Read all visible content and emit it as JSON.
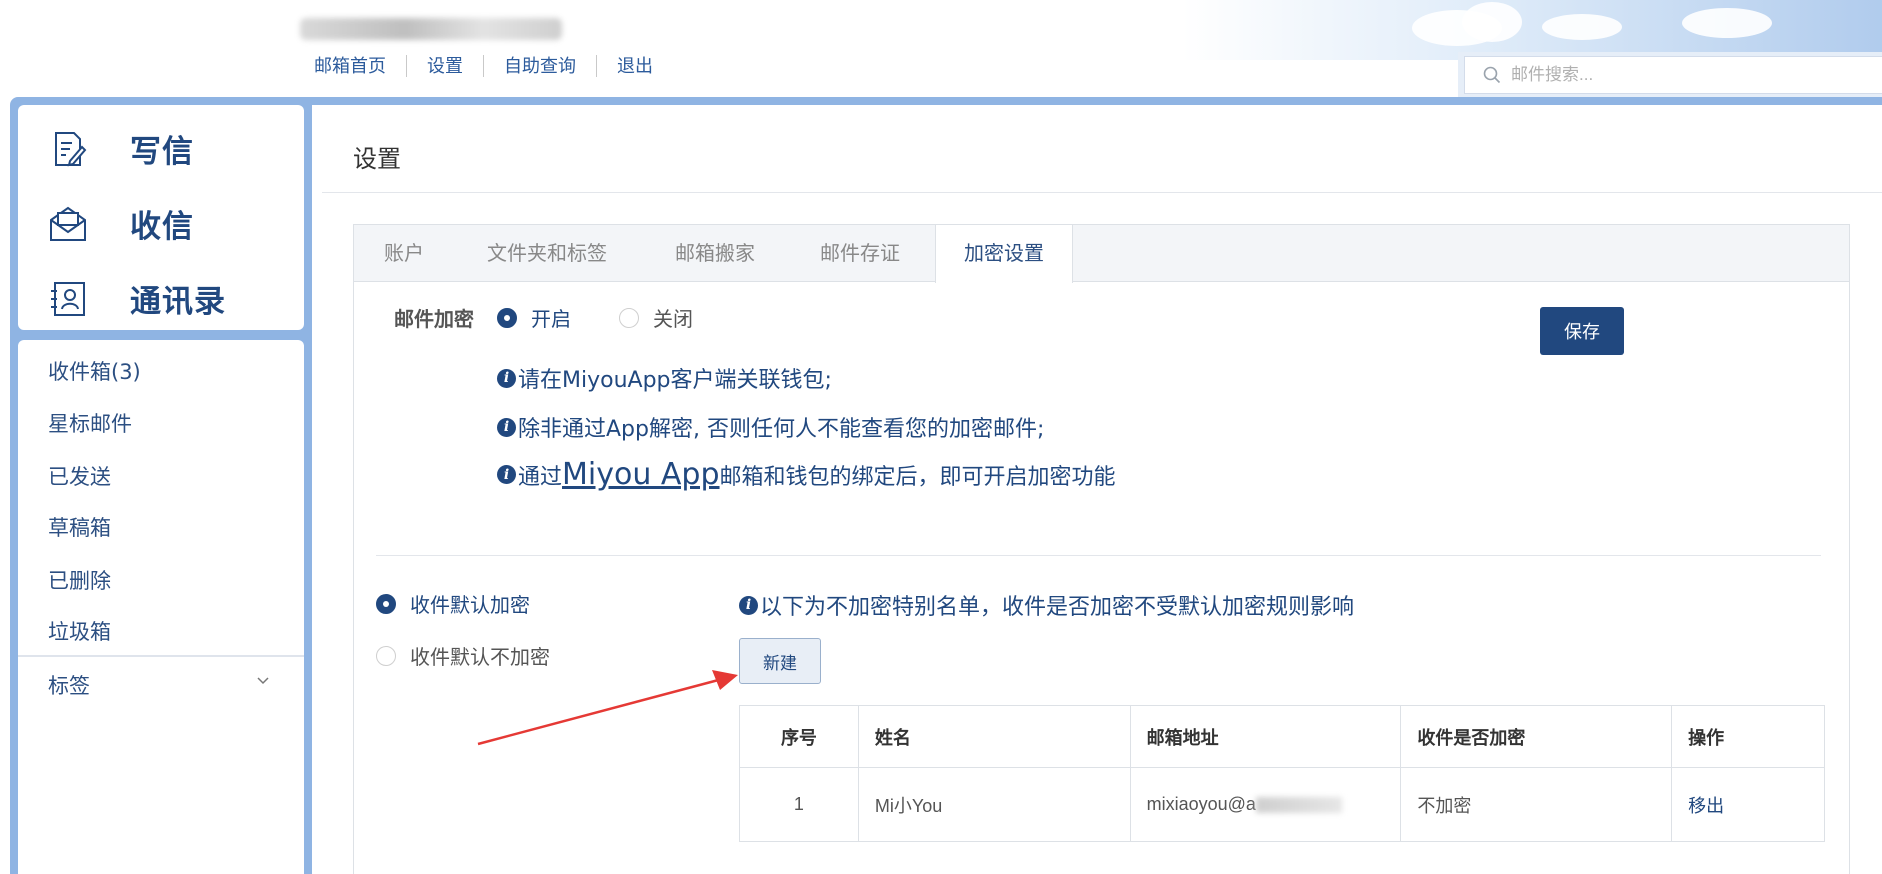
{
  "header": {
    "nav": [
      "邮箱首页",
      "设置",
      "自助查询",
      "退出"
    ],
    "search_placeholder": "邮件搜索..."
  },
  "sidebar": {
    "actions": [
      {
        "label": "写信",
        "icon": "compose-icon"
      },
      {
        "label": "收信",
        "icon": "inbox-envelope-icon"
      },
      {
        "label": "通讯录",
        "icon": "contacts-icon"
      }
    ],
    "folders": [
      "收件箱(3)",
      "星标邮件",
      "已发送",
      "草稿箱",
      "已删除",
      "垃圾箱"
    ],
    "tags_label": "标签"
  },
  "main": {
    "title": "设置",
    "tabs": [
      "账户",
      "文件夹和标签",
      "邮箱搬家",
      "邮件存证",
      "加密设置"
    ],
    "active_tab": "加密设置",
    "encryption": {
      "label": "邮件加密",
      "on": "开启",
      "off": "关闭",
      "selected": "开启"
    },
    "save_label": "保存",
    "info": [
      "请在MiyouApp客户端关联钱包;",
      "除非通过App解密, 否则任何人不能查看您的加密邮件;"
    ],
    "info3": {
      "before": "通过",
      "link": "Miyou App",
      "after": "邮箱和钱包的绑定后，即可开启加密功能"
    },
    "receive": {
      "default_encrypt": "收件默认加密",
      "default_no_encrypt": "收件默认不加密",
      "selected": "收件默认加密"
    },
    "exception_note": "以下为不加密特别名单，收件是否加密不受默认加密规则影响",
    "new_label": "新建",
    "table": {
      "headers": [
        "序号",
        "姓名",
        "邮箱地址",
        "收件是否加密",
        "操作"
      ],
      "rows": [
        {
          "index": "1",
          "name": "Mi小You",
          "email": "mixiaoyou@a",
          "encrypted": "不加密",
          "action": "移出"
        }
      ]
    }
  },
  "colors": {
    "brand": "#21487f",
    "frame": "#8fb4e3",
    "annotation_arrow": "#e53935"
  }
}
